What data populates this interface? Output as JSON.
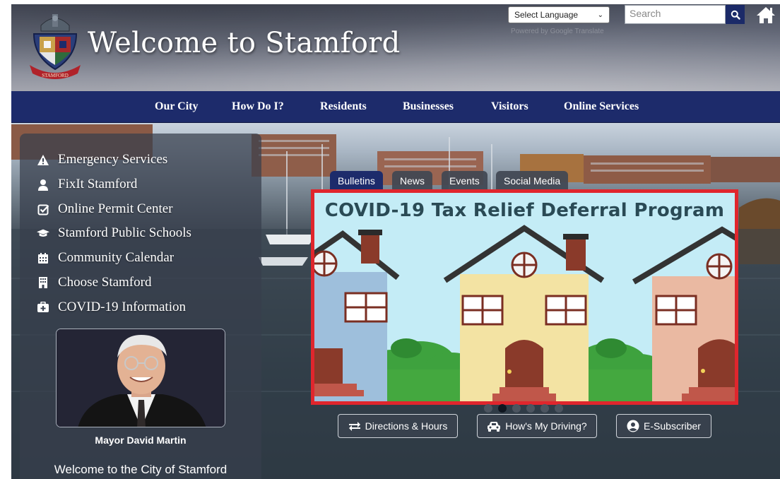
{
  "header": {
    "site_title": "Welcome to Stamford",
    "seal_text": "STAMFORD",
    "language_select": {
      "selected": "Select Language"
    },
    "powered_by": "Powered by Google Translate",
    "search": {
      "placeholder": "Search"
    }
  },
  "nav": {
    "items": [
      {
        "label": "Our City"
      },
      {
        "label": "How Do I?"
      },
      {
        "label": "Residents"
      },
      {
        "label": "Businesses"
      },
      {
        "label": "Visitors"
      },
      {
        "label": "Online Services"
      }
    ]
  },
  "sidebar": {
    "quick_links": [
      {
        "label": "Emergency Services",
        "icon": "warning-icon"
      },
      {
        "label": "FixIt Stamford",
        "icon": "person-icon"
      },
      {
        "label": "Online Permit Center",
        "icon": "checkbox-icon"
      },
      {
        "label": "Stamford Public Schools",
        "icon": "graduation-cap-icon"
      },
      {
        "label": "Community Calendar",
        "icon": "calendar-icon"
      },
      {
        "label": "Choose Stamford",
        "icon": "building-icon"
      },
      {
        "label": "COVID-19 Information",
        "icon": "medkit-icon"
      }
    ],
    "mayor_caption": "Mayor David Martin",
    "welcome_text": "Welcome to the City of Stamford"
  },
  "tabs": [
    {
      "label": "Bulletins",
      "active": true
    },
    {
      "label": "News",
      "active": false
    },
    {
      "label": "Events",
      "active": false
    },
    {
      "label": "Social Media",
      "active": false
    }
  ],
  "slide": {
    "title": "COVID-19 Tax Relief Deferral Program",
    "current_index": 2,
    "count": 6
  },
  "actions": [
    {
      "label": "Directions & Hours",
      "icon": "exchange-icon"
    },
    {
      "label": "How's My Driving?",
      "icon": "car-icon"
    },
    {
      "label": "E-Subscriber",
      "icon": "user-circle-icon"
    }
  ],
  "colors": {
    "nav_bg": "#1d2b6b",
    "slide_border": "#e0262d",
    "slide_bg": "#c4ecf6"
  }
}
